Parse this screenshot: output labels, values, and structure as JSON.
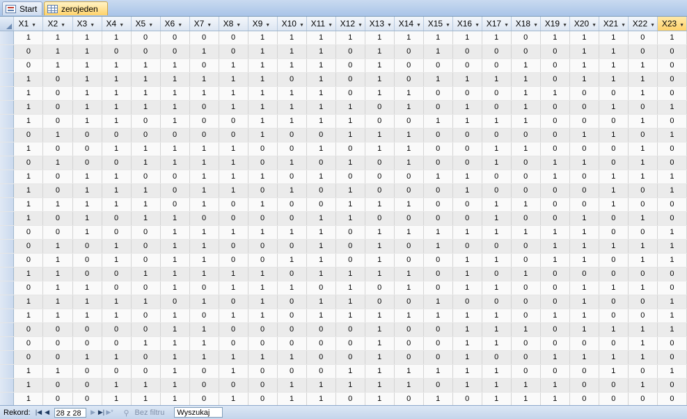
{
  "tabs": [
    {
      "label": "Start",
      "icon": "form-icon"
    },
    {
      "label": "zerojeden",
      "icon": "table-icon"
    }
  ],
  "columns": [
    "X1",
    "X2",
    "X3",
    "X4",
    "X5",
    "X6",
    "X7",
    "X8",
    "X9",
    "X10",
    "X11",
    "X12",
    "X13",
    "X14",
    "X15",
    "X16",
    "X17",
    "X18",
    "X19",
    "X20",
    "X21",
    "X22",
    "X23"
  ],
  "active_column": "X23",
  "rows": [
    [
      1,
      1,
      1,
      1,
      0,
      0,
      0,
      0,
      1,
      1,
      1,
      1,
      1,
      1,
      1,
      1,
      1,
      0,
      1,
      1,
      1,
      0,
      1
    ],
    [
      0,
      1,
      1,
      0,
      0,
      0,
      1,
      0,
      1,
      1,
      1,
      0,
      1,
      0,
      1,
      0,
      0,
      0,
      0,
      1,
      1,
      0,
      0
    ],
    [
      0,
      1,
      1,
      1,
      1,
      1,
      0,
      1,
      1,
      1,
      1,
      0,
      1,
      0,
      0,
      0,
      0,
      1,
      0,
      1,
      1,
      1,
      0
    ],
    [
      1,
      0,
      1,
      1,
      1,
      1,
      1,
      1,
      1,
      0,
      1,
      0,
      1,
      0,
      1,
      1,
      1,
      1,
      0,
      1,
      1,
      1,
      0
    ],
    [
      1,
      0,
      1,
      1,
      1,
      1,
      1,
      1,
      1,
      1,
      1,
      0,
      1,
      1,
      0,
      0,
      0,
      1,
      1,
      0,
      0,
      1,
      0
    ],
    [
      1,
      0,
      1,
      1,
      1,
      1,
      0,
      1,
      1,
      1,
      1,
      1,
      0,
      1,
      0,
      1,
      0,
      1,
      0,
      0,
      1,
      0,
      1
    ],
    [
      1,
      0,
      1,
      1,
      0,
      1,
      0,
      0,
      1,
      1,
      1,
      1,
      0,
      0,
      1,
      1,
      1,
      1,
      0,
      0,
      0,
      1,
      0
    ],
    [
      0,
      1,
      0,
      0,
      0,
      0,
      0,
      0,
      1,
      0,
      0,
      1,
      1,
      1,
      0,
      0,
      0,
      0,
      0,
      1,
      1,
      0,
      1
    ],
    [
      1,
      0,
      0,
      1,
      1,
      1,
      1,
      1,
      0,
      0,
      1,
      0,
      1,
      1,
      0,
      0,
      1,
      1,
      0,
      0,
      0,
      1,
      0
    ],
    [
      0,
      1,
      0,
      0,
      1,
      1,
      1,
      1,
      0,
      1,
      0,
      1,
      0,
      1,
      0,
      0,
      1,
      0,
      1,
      1,
      0,
      1,
      0
    ],
    [
      1,
      0,
      1,
      1,
      0,
      0,
      1,
      1,
      1,
      0,
      1,
      0,
      0,
      0,
      1,
      1,
      0,
      0,
      1,
      0,
      1,
      1,
      1
    ],
    [
      1,
      0,
      1,
      1,
      1,
      0,
      1,
      1,
      0,
      1,
      0,
      1,
      0,
      0,
      0,
      1,
      0,
      0,
      0,
      0,
      1,
      0,
      1
    ],
    [
      1,
      1,
      1,
      1,
      1,
      0,
      1,
      0,
      1,
      0,
      0,
      1,
      1,
      1,
      0,
      0,
      1,
      1,
      0,
      0,
      1,
      0,
      0
    ],
    [
      1,
      0,
      1,
      0,
      1,
      1,
      0,
      0,
      0,
      0,
      1,
      1,
      0,
      0,
      0,
      0,
      1,
      0,
      0,
      1,
      0,
      1,
      0
    ],
    [
      0,
      0,
      1,
      0,
      0,
      1,
      1,
      1,
      1,
      1,
      1,
      0,
      1,
      1,
      1,
      1,
      1,
      1,
      1,
      1,
      0,
      0,
      1
    ],
    [
      0,
      1,
      0,
      1,
      0,
      1,
      1,
      0,
      0,
      0,
      1,
      0,
      1,
      0,
      1,
      0,
      0,
      0,
      1,
      1,
      1,
      1,
      1
    ],
    [
      0,
      1,
      0,
      1,
      0,
      1,
      1,
      0,
      0,
      1,
      1,
      0,
      1,
      0,
      0,
      1,
      1,
      0,
      1,
      1,
      0,
      1,
      1
    ],
    [
      1,
      1,
      0,
      0,
      1,
      1,
      1,
      1,
      1,
      0,
      1,
      1,
      1,
      1,
      0,
      1,
      0,
      1,
      0,
      0,
      0,
      0,
      0
    ],
    [
      0,
      1,
      1,
      0,
      0,
      1,
      0,
      1,
      1,
      1,
      0,
      1,
      0,
      1,
      0,
      1,
      1,
      0,
      0,
      1,
      1,
      1,
      0
    ],
    [
      1,
      1,
      1,
      1,
      1,
      0,
      1,
      0,
      1,
      0,
      1,
      1,
      0,
      0,
      1,
      0,
      0,
      0,
      0,
      1,
      0,
      0,
      1
    ],
    [
      1,
      1,
      1,
      1,
      0,
      1,
      0,
      1,
      1,
      0,
      1,
      1,
      1,
      1,
      1,
      1,
      1,
      0,
      1,
      1,
      0,
      0,
      1
    ],
    [
      0,
      0,
      0,
      0,
      0,
      1,
      1,
      0,
      0,
      0,
      0,
      0,
      1,
      0,
      0,
      1,
      1,
      1,
      0,
      1,
      1,
      1,
      1
    ],
    [
      0,
      0,
      0,
      0,
      1,
      1,
      1,
      0,
      0,
      0,
      0,
      0,
      1,
      0,
      0,
      1,
      1,
      0,
      0,
      0,
      0,
      1,
      0
    ],
    [
      0,
      0,
      1,
      1,
      0,
      1,
      1,
      1,
      1,
      1,
      0,
      0,
      1,
      0,
      0,
      1,
      0,
      0,
      1,
      1,
      1,
      1,
      0
    ],
    [
      1,
      1,
      0,
      0,
      0,
      1,
      0,
      1,
      0,
      0,
      0,
      1,
      1,
      1,
      1,
      1,
      1,
      0,
      0,
      0,
      1,
      0,
      1
    ],
    [
      1,
      0,
      0,
      1,
      1,
      1,
      0,
      0,
      0,
      1,
      1,
      1,
      1,
      1,
      0,
      1,
      1,
      1,
      1,
      0,
      0,
      1,
      0
    ],
    [
      1,
      0,
      0,
      1,
      1,
      1,
      0,
      1,
      0,
      1,
      1,
      0,
      1,
      0,
      1,
      0,
      1,
      1,
      1,
      0,
      0,
      0,
      0
    ]
  ],
  "statusbar": {
    "record_label": "Rekord:",
    "record_position": "28 z 28",
    "filter_label": "Bez filtru",
    "search_placeholder": "Wyszukaj"
  }
}
